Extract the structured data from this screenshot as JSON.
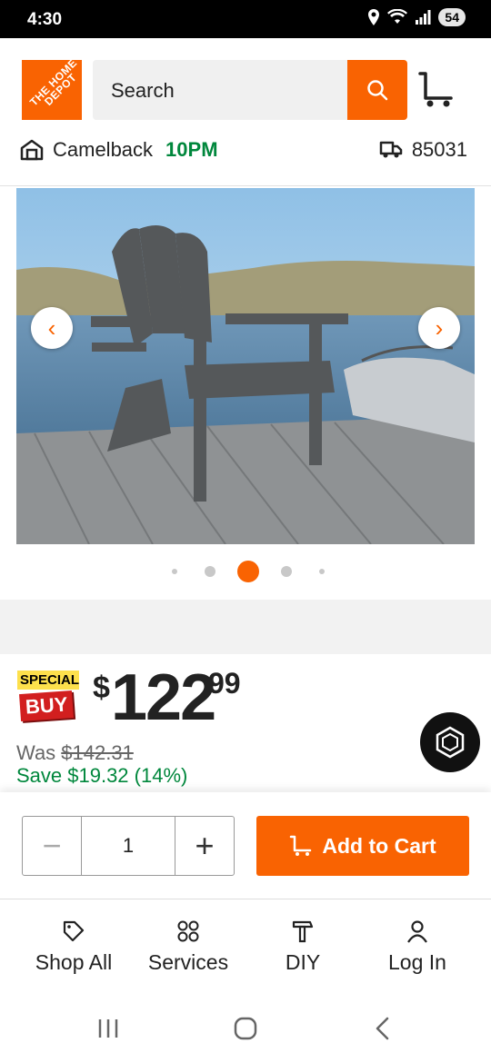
{
  "status_bar": {
    "time": "4:30",
    "battery": "54"
  },
  "header": {
    "logo_text": "THE HOME DEPOT",
    "search_placeholder": "Search",
    "store_name": "Camelback",
    "store_hours": "10PM",
    "zip_code": "85031"
  },
  "gallery": {
    "total_dots": 5,
    "active_dot": 2
  },
  "pricing": {
    "badge_line1": "SPECIAL",
    "badge_line2": "BUY",
    "currency": "$",
    "price_dollars": "122",
    "price_cents": "99",
    "was_label": "Was ",
    "was_price": "$142.31",
    "save_text": "Save $19.32 (14%)"
  },
  "cart": {
    "quantity": "1",
    "add_label": "Add to Cart"
  },
  "bottom_nav": {
    "items": [
      {
        "label": "Shop All",
        "icon": "tag-icon"
      },
      {
        "label": "Services",
        "icon": "grid-icon"
      },
      {
        "label": "DIY",
        "icon": "hammer-icon"
      },
      {
        "label": "Log In",
        "icon": "person-icon"
      }
    ]
  },
  "colors": {
    "brand": "#f96302",
    "green": "#00873c",
    "sale_red": "#d21f1f",
    "sale_yellow": "#fde04c"
  }
}
